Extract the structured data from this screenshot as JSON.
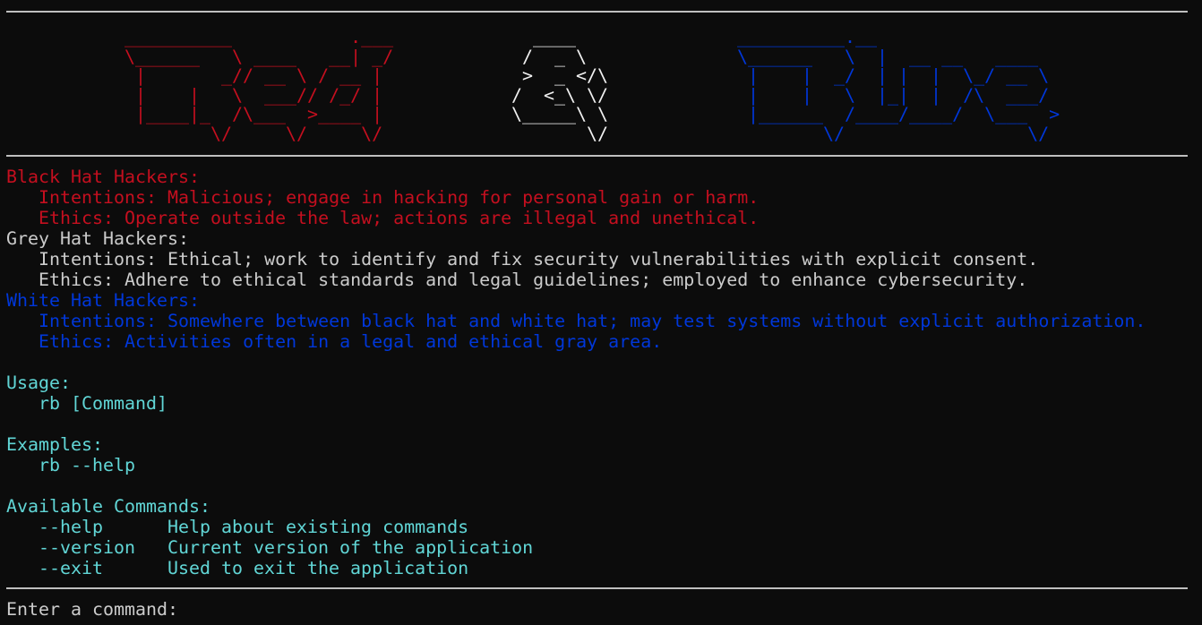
{
  "banner": {
    "red_art": " __________           .___\n \\______   \\ ____   __| _/\n  |       _// __ \\ / __ | \n  |    |   \\  ___// /_/ | \n  |____|_  /\\___  >____ | \n         \\/     \\/     \\/ ",
    "amp_art": "  ____     \n /  _ \\    \n >  _ </\\  \n/  <_\\ \\/  \n\\_____\\ \\  \n       \\/  ",
    "blue_art": "__________.__               \n\\______   \\  |  __ __   ____  \n |    |  _/  | |  |  \\_/ __ \\ \n |    |   \\  |_|  |  /\\  ___/ \n |______  /____/____/  \\___  >\n        \\/                 \\/ "
  },
  "sections": {
    "black": {
      "heading": "Black Hat Hackers:",
      "intentions": "Intentions: Malicious; engage in hacking for personal gain or harm.",
      "ethics": "Ethics: Operate outside the law; actions are illegal and unethical."
    },
    "grey": {
      "heading": "Grey Hat Hackers:",
      "intentions": "Intentions: Ethical; work to identify and fix security vulnerabilities with explicit consent.",
      "ethics": "Ethics: Adhere to ethical standards and legal guidelines; employed to enhance cybersecurity."
    },
    "white": {
      "heading": "White Hat Hackers:",
      "intentions": "Intentions: Somewhere between black hat and white hat; may test systems without explicit authorization.",
      "ethics": "Ethics: Activities often in a legal and ethical gray area."
    }
  },
  "usage": {
    "heading": "Usage:",
    "line": "rb [Command]"
  },
  "examples": {
    "heading": "Examples:",
    "line": "rb --help"
  },
  "commands": {
    "heading": "Available Commands:",
    "items": [
      {
        "name": "--help",
        "desc": "Help about existing commands"
      },
      {
        "name": "--version",
        "desc": "Current version of the application"
      },
      {
        "name": "--exit",
        "desc": "Used to exit the application"
      }
    ]
  },
  "prompt": {
    "label": "Enter a command: "
  },
  "colors": {
    "background": "#0c0c0c",
    "red": "#c50f1f",
    "grey": "#cccccc",
    "blue": "#0037da",
    "cyan": "#61d6d6",
    "white": "#f2f2f2",
    "rule": "#bfbfbf"
  }
}
